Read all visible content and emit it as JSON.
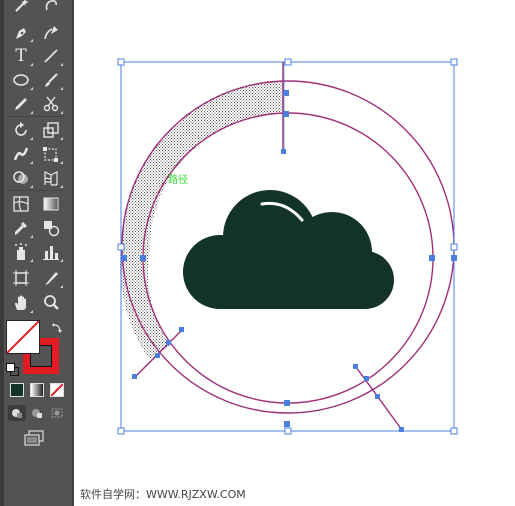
{
  "toolbar": {
    "tools": [
      {
        "name": "selection-tool",
        "icon": "arrow-icon"
      },
      {
        "name": "direct-selection-tool",
        "icon": "white-arrow-icon"
      },
      {
        "name": "pen-tool",
        "icon": "pen-icon"
      },
      {
        "name": "curvature-tool",
        "icon": "curvature-icon"
      },
      {
        "name": "type-tool",
        "icon": "type-icon",
        "glyph": "T"
      },
      {
        "name": "line-segment-tool",
        "icon": "line-icon"
      },
      {
        "name": "ellipse-tool",
        "icon": "ellipse-icon"
      },
      {
        "name": "paintbrush-tool",
        "icon": "brush-icon"
      },
      {
        "name": "pencil-tool",
        "icon": "pencil-icon"
      },
      {
        "name": "scissors-tool",
        "icon": "scissors-icon"
      },
      {
        "name": "rotate-tool",
        "icon": "rotate-icon"
      },
      {
        "name": "scale-tool",
        "icon": "scale-icon"
      },
      {
        "name": "warp-tool",
        "icon": "warp-icon"
      },
      {
        "name": "free-transform-tool",
        "icon": "free-transform-icon"
      },
      {
        "name": "shape-builder-tool",
        "icon": "shape-builder-icon"
      },
      {
        "name": "perspective-grid-tool",
        "icon": "perspective-grid-icon"
      },
      {
        "name": "mesh-tool",
        "icon": "mesh-icon"
      },
      {
        "name": "gradient-tool",
        "icon": "gradient-icon"
      },
      {
        "name": "eyedropper-tool",
        "icon": "eyedropper-icon"
      },
      {
        "name": "blend-tool",
        "icon": "blend-icon"
      },
      {
        "name": "symbol-sprayer-tool",
        "icon": "symbol-sprayer-icon"
      },
      {
        "name": "column-graph-tool",
        "icon": "column-graph-icon"
      },
      {
        "name": "artboard-tool",
        "icon": "artboard-icon"
      },
      {
        "name": "slice-tool",
        "icon": "slice-icon"
      },
      {
        "name": "hand-tool",
        "icon": "hand-icon"
      },
      {
        "name": "zoom-tool",
        "icon": "zoom-icon"
      }
    ],
    "fill_stroke": {
      "fill": "none",
      "stroke_color": "#e31b23"
    },
    "color_modes": [
      "color",
      "gradient",
      "none"
    ],
    "draw_modes": [
      "draw-normal",
      "draw-behind",
      "draw-inside"
    ],
    "screen_mode": "screen-mode-icon"
  },
  "artwork": {
    "cloud_color": "#13322a",
    "path_color": "#a0307a",
    "bbox_color": "#4a7fe0",
    "smart_guide_color": "#33dd33",
    "smart_guide_label": "路径"
  },
  "watermark": "软件自学网：WWW.RJZXW.COM"
}
